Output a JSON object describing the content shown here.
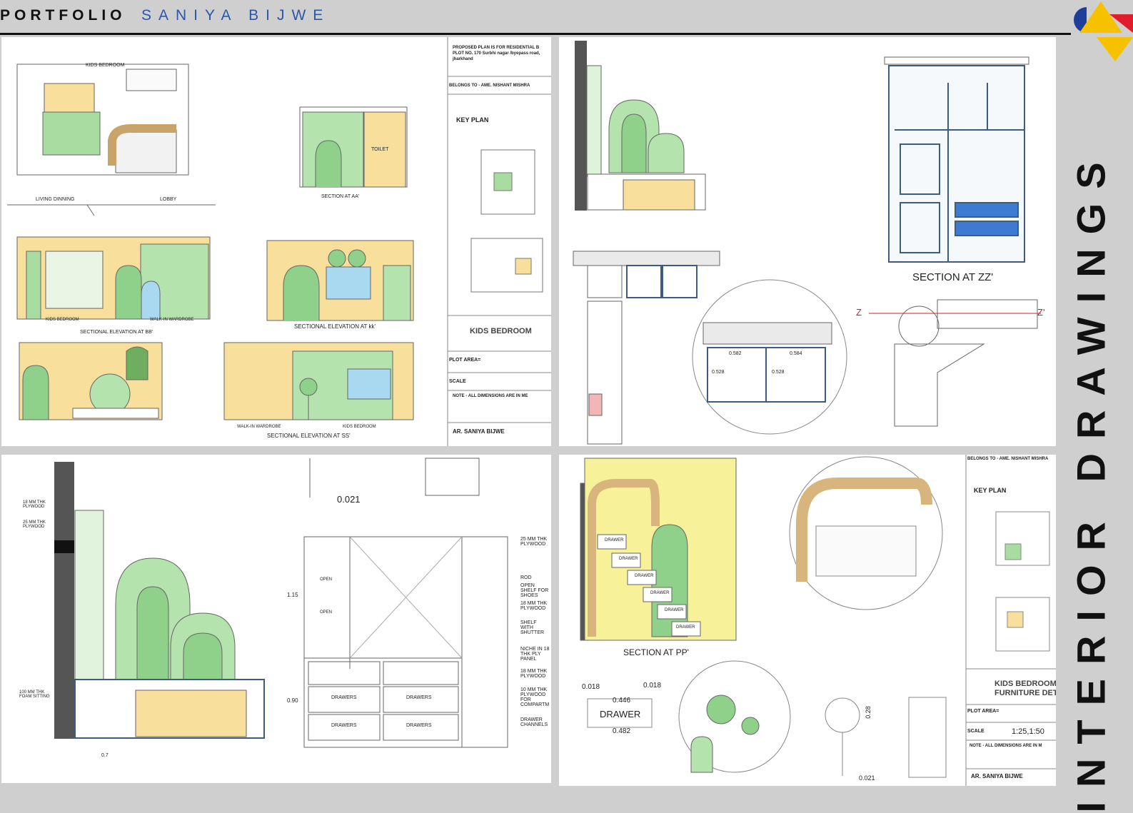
{
  "header": {
    "brand": "PORTFOLIO",
    "author": "SANIYA BIJWE"
  },
  "side_title": "INTERIOR DRAWINGS",
  "colors": {
    "header_bg": "#cfcfcf",
    "accent_blue": "#2b57a8",
    "logo_red": "#e01e2b",
    "logo_yellow": "#f6c200",
    "logo_navy": "#1e3f99",
    "drawing_green": "#8fd18b",
    "drawing_cream": "#f8df9c",
    "drawing_tan": "#d9b57e",
    "drawing_yellow": "#f7f29a"
  },
  "sheet1": {
    "room_label_kids": "KIDS BEDROOM",
    "room_label_living": "LIVING DINNING",
    "room_label_lobby": "LOBBY",
    "label_toilet": "TOILET",
    "section_aa": "SECTION AT AA'",
    "elev_kids": "KIDS BEDROOM",
    "elev_walkin": "WALK-IN WARDROBE",
    "section_bb": "SECTIONAL ELEVATION AT BB'",
    "section_kk": "SECTIONAL ELEVATION AT kk'",
    "elev_walkin2": "WALK-IN WARDROBE",
    "elev_kids2": "KIDS BEDROOM",
    "section_ss": "SECTIONAL ELEVATION AT SS'",
    "titleblock": {
      "proposal": "PROPOSED PLAN IS FOR RESIDENTIAL B",
      "plot": "PLOT NO. 170 Surbhi nagar /byepass road,",
      "state": "jharkhand",
      "belongs": "BELONGS TO - AME. NISHANT MISHRA",
      "key_plan": "KEY PLAN",
      "drawing_title": "KIDS BEDROOM",
      "plot_area": "PLOT AREA=",
      "scale": "SCALE",
      "note": "NOTE - ALL DIMENSIONS ARE IN ME",
      "architect": "AR. SANIYA BIJWE"
    }
  },
  "sheet2": {
    "section_zz": "SECTION AT ZZ'",
    "z_left": "Z",
    "z_right": "Z'",
    "dim_582": "0.582",
    "dim_584": "0.584",
    "dim_528a": "0.528",
    "dim_528b": "0.528"
  },
  "sheet3": {
    "dim_top": "0.021",
    "lbl_18mm": "18 MM THK PLYWOOD",
    "lbl_25mm": "25 MM THK PLYWOOD",
    "lbl_foam": "100 MM THK FOAM SITTING",
    "dim_115": "1.15",
    "dim_090": "0.90",
    "dim_087": "0.7",
    "notes": [
      "25 MM THK PLYWOOD",
      "ROD",
      "OPEN SHELF FOR SHOES",
      "18 MM THK PLYWOOD",
      "SHELF WITH SHUTTER",
      "NICHE IN 18 THK PLY PANEL",
      "18 MM THK PLYWOOD",
      "10 MM THK PLYWOOD FOR COMPARTM",
      "DRAWER CHANNELS"
    ],
    "drawers": [
      "DRAWERS",
      "DRAWERS",
      "DRAWERS",
      "DRAWERS"
    ],
    "open_labels": [
      "OPEN",
      "OPEN"
    ]
  },
  "sheet4": {
    "section_pp": "SECTION AT PP'",
    "drawer_detail": "DRAWER",
    "dim_018a": "0.018",
    "dim_018b": "0.018",
    "dim_446": "0.446",
    "dim_482": "0.482",
    "dim_021": "0.021",
    "dim_028": "0.28",
    "drawer_steps": [
      "DRAWER",
      "DRAWER",
      "DRAWER",
      "DRAWER",
      "DRAWER",
      "DRAWER"
    ],
    "titleblock": {
      "belongs": "BELONGS TO - AME. NISHANT MISHRA",
      "key_plan": "KEY PLAN",
      "title1": "KIDS BEDROOM",
      "title2": "FURNITURE DET",
      "plot_area": "PLOT AREA=",
      "scale": "SCALE",
      "scale_value": "1:25,1:50",
      "note": "NOTE - ALL DIMENSIONS ARE IN M",
      "architect": "AR. SANIYA BIJWE"
    }
  }
}
